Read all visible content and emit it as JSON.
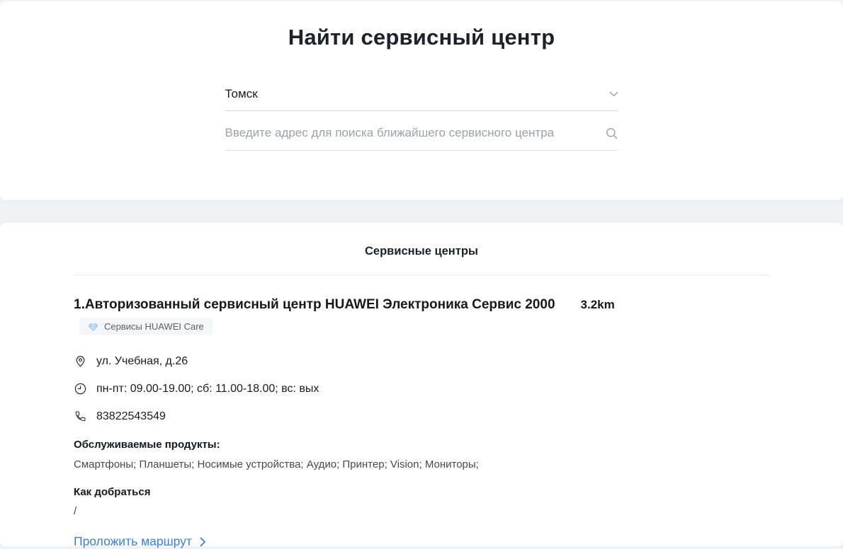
{
  "finder": {
    "title": "Найти сервисный центр",
    "city_select": {
      "value": "Томск"
    },
    "search": {
      "placeholder": "Введите адрес для поиска ближайшего сервисного центра"
    }
  },
  "results": {
    "header": "Сервисные центры",
    "centers": [
      {
        "name": "1.Авторизованный сервисный центр HUAWEI Электроника Сервис 2000",
        "distance": "3.2km",
        "badge": "Сервисы HUAWEI Care",
        "address": "ул. Учебная, д.26",
        "hours": "пн-пт: 09.00-19.00; сб: 11.00-18.00; вс: вых",
        "phone": "83822543549",
        "products_label": "Обслуживаемые продукты:",
        "products": "Смартфоны; Планшеты; Носимые устройства; Аудио; Принтер; Vision; Мониторы;",
        "directions_label": "Как добраться",
        "directions_value": "/",
        "route_link": "Проложить маршрут"
      }
    ]
  },
  "icons": {
    "city_chevron": "chevron-down",
    "search": "magnifier",
    "badge_heart": "huawei-care-heart",
    "address": "map-pin",
    "hours": "clock",
    "phone": "phone-handset",
    "route": "chevron-right"
  },
  "colors": {
    "link_blue": "#3b7fdc",
    "heart_blue": "#a9cdf3",
    "page_background": "#f0f1f5"
  }
}
